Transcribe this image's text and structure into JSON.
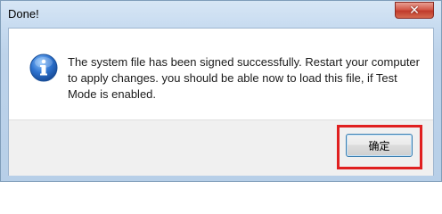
{
  "window": {
    "title": "Done!",
    "close_glyph": "✕"
  },
  "dialog": {
    "icon": "info-icon",
    "message": "The system file has been signed successfully. Restart your computer to apply changes. you should be able now to load this file, if Test Mode is enabled.",
    "ok_label": "确定"
  },
  "colors": {
    "highlight": "#e02020",
    "icon_blue": "#1f5fb8"
  }
}
